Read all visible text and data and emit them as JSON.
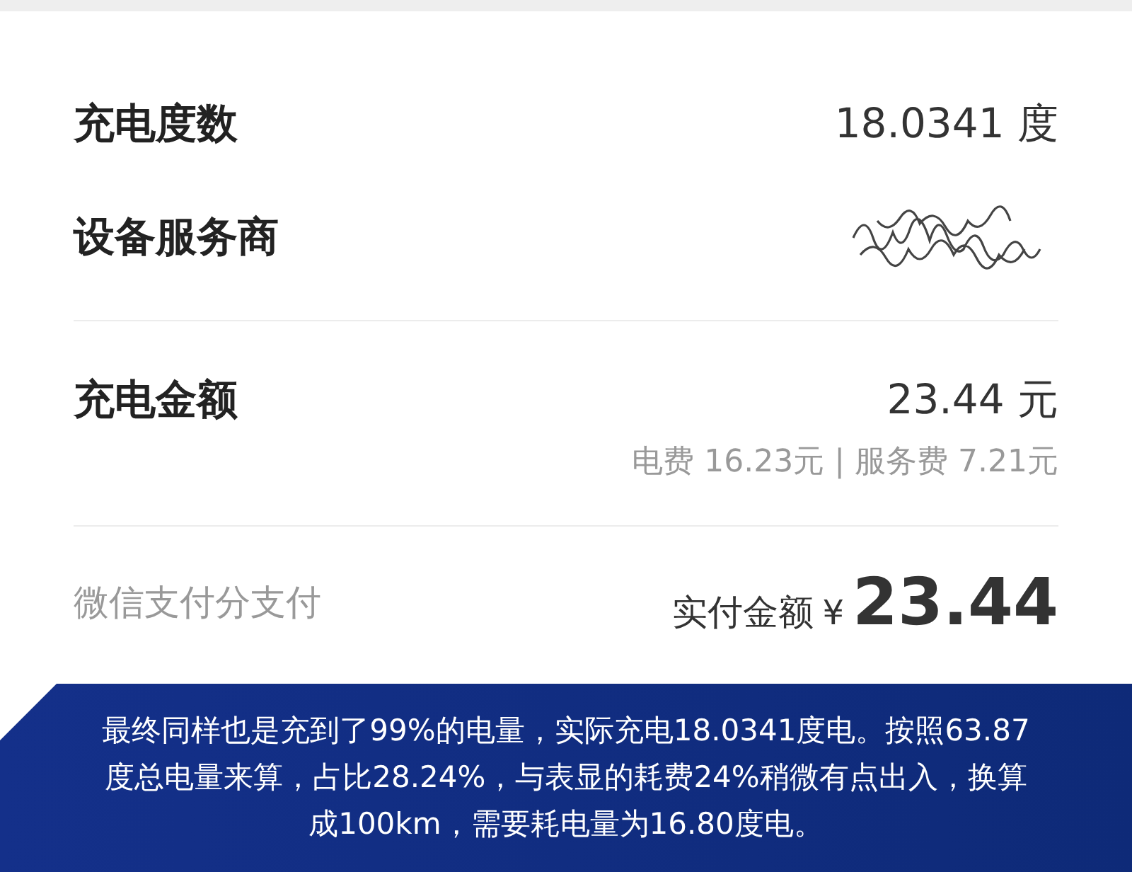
{
  "details": [
    {
      "label": "充电度数",
      "value": "18.0341 度",
      "kind": "text"
    },
    {
      "label": "设备服务商",
      "kind": "redacted"
    }
  ],
  "amount": {
    "label": "充电金额",
    "value": "23.44 元",
    "breakdown": "电费 16.23元 | 服务费 7.21元"
  },
  "payment": {
    "method": "微信支付分支付",
    "paid_label": "实付金额",
    "currency": "¥",
    "paid_value": "23.44"
  },
  "caption": "最终同样也是充到了99%的电量，实际充电18.0341度电。按照63.87度总电量来算，占比28.24%，与表显的耗费24%稍微有点出入，换算成100km，需要耗电量为16.80度电。"
}
